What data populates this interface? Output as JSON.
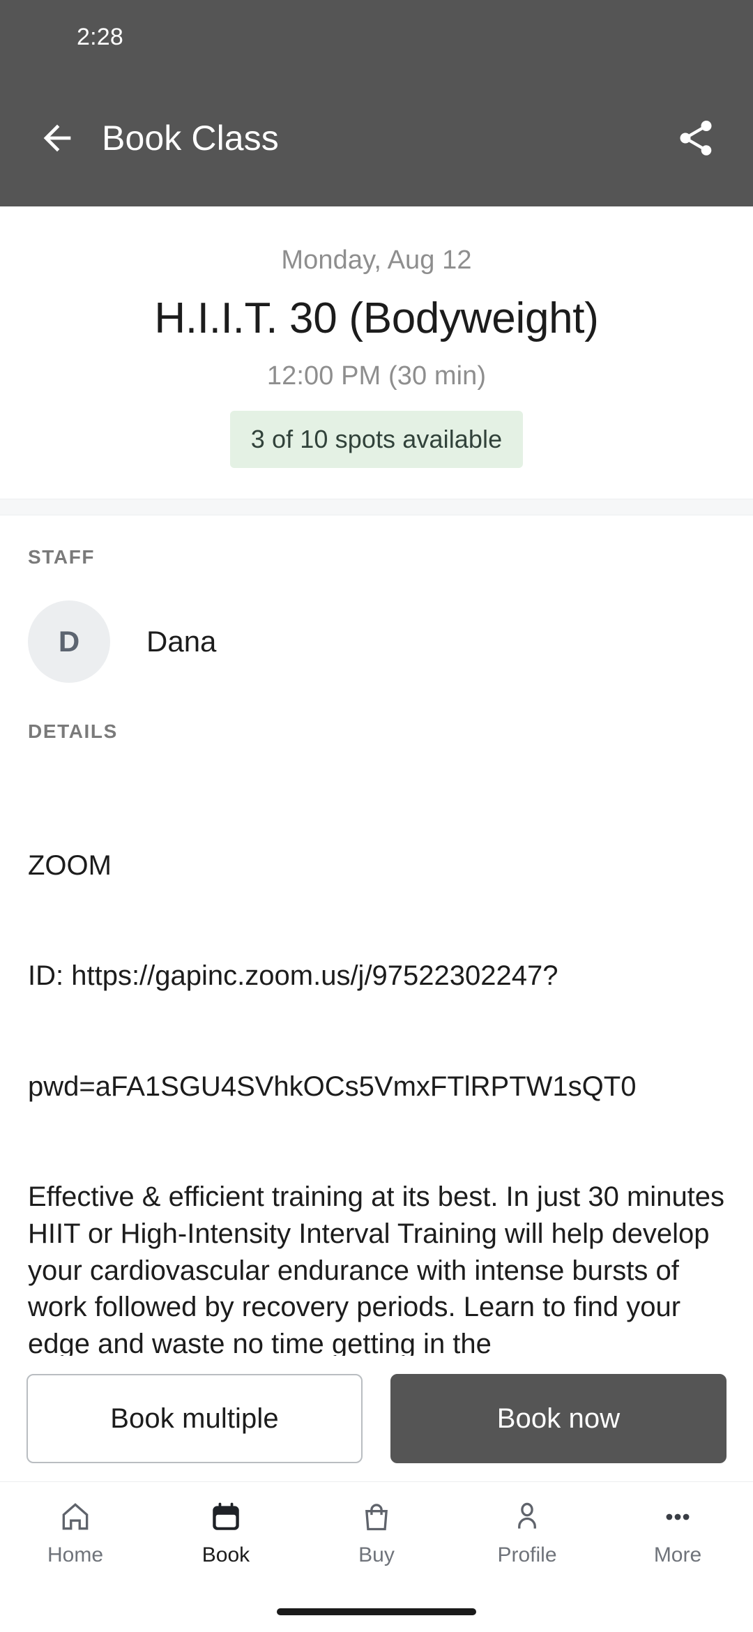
{
  "status_bar": {
    "clock": "2:28"
  },
  "app_bar": {
    "title": "Book Class",
    "back_icon": "arrow-left-icon",
    "share_icon": "share-icon"
  },
  "class_header": {
    "date": "Monday, Aug 12",
    "name": "H.I.I.T. 30 (Bodyweight)",
    "time": "12:00 PM (30 min)",
    "availability": "3 of 10 spots available",
    "availability_bg": "#e4f1e4",
    "availability_text_color": "#31423a"
  },
  "staff": {
    "label": "STAFF",
    "avatar_initial": "D",
    "name": "Dana"
  },
  "details": {
    "label": "DETAILS",
    "line_zoom": "ZOOM",
    "line_id": "ID: https://gapinc.zoom.us/j/97522302247?",
    "line_pwd": "pwd=aFA1SGU4SVhkOCs5VmxFTlRPTW1sQT0",
    "description": "Effective & efficient training at its best. In just 30 minutes HIIT or High-Intensity Interval Training will help develop your cardiovascular endurance with intense bursts of work followed by recovery periods. Learn to find your edge and waste no time getting in the"
  },
  "actions": {
    "book_multiple": "Book multiple",
    "book_now": "Book now",
    "primary_color": "#555555"
  },
  "bottom_nav": {
    "items": [
      {
        "label": "Home",
        "icon": "home-icon",
        "active": false
      },
      {
        "label": "Book",
        "icon": "calendar-icon",
        "active": true
      },
      {
        "label": "Buy",
        "icon": "shopping-bag-icon",
        "active": false
      },
      {
        "label": "Profile",
        "icon": "person-icon",
        "active": false
      },
      {
        "label": "More",
        "icon": "more-dots-icon",
        "active": false
      }
    ]
  }
}
